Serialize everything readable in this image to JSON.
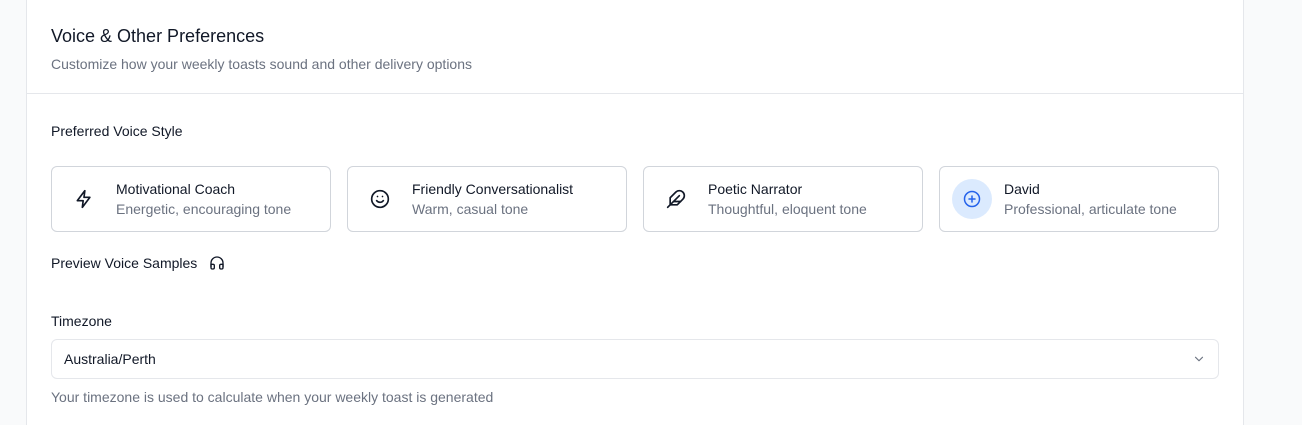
{
  "header": {
    "title": "Voice & Other Preferences",
    "subtitle": "Customize how your weekly toasts sound and other delivery options"
  },
  "voice": {
    "label": "Preferred Voice Style",
    "options": [
      {
        "name": "Motivational Coach",
        "description": "Energetic, encouraging tone",
        "icon": "lightning-icon"
      },
      {
        "name": "Friendly Conversationalist",
        "description": "Warm, casual tone",
        "icon": "smile-icon"
      },
      {
        "name": "Poetic Narrator",
        "description": "Thoughtful, eloquent tone",
        "icon": "feather-icon"
      },
      {
        "name": "David",
        "description": "Professional, articulate tone",
        "icon": "plus-circle-icon",
        "selected": true
      }
    ]
  },
  "preview": {
    "label": "Preview Voice Samples",
    "icon": "headphones-icon"
  },
  "timezone": {
    "label": "Timezone",
    "value": "Australia/Perth",
    "helper": "Your timezone is used to calculate when your weekly toast is generated"
  },
  "colors": {
    "accent": "#2563eb",
    "selected_bg": "#dbeafe"
  }
}
